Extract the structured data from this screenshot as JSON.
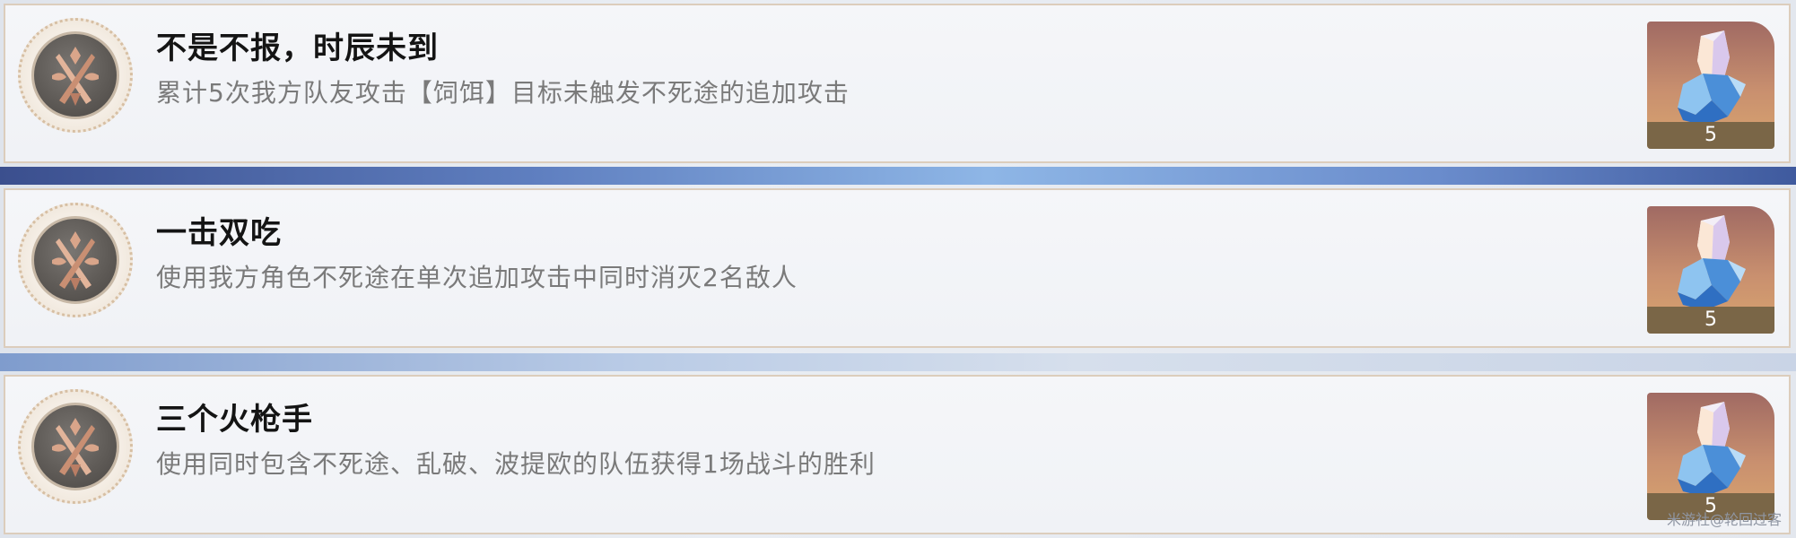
{
  "achievements": [
    {
      "title": "不是不报，时辰未到",
      "description": "累计5次我方队友攻击【饲饵】目标未触发不死途的追加攻击",
      "reward_count": "5",
      "medal_icon": "crossed-blades-medal-icon",
      "reward_icon": "stellar-jade-crystal-icon"
    },
    {
      "title": "一击双吃",
      "description": "使用我方角色不死途在单次追加攻击中同时消灭2名敌人",
      "reward_count": "5",
      "medal_icon": "crossed-blades-medal-icon",
      "reward_icon": "stellar-jade-crystal-icon"
    },
    {
      "title": "三个火枪手",
      "description": "使用同时包含不死途、乱破、波提欧的队伍获得1场战斗的胜利",
      "reward_count": "5",
      "medal_icon": "crossed-blades-medal-icon",
      "reward_icon": "stellar-jade-crystal-icon"
    }
  ],
  "watermark": "米游社@轮回过客",
  "colors": {
    "title_text": "#141414",
    "description_text": "#7a7a7a",
    "card_border": "#dccdbc",
    "reward_bg": "#c9906f",
    "reward_count_bar": "#7a6647",
    "band_blue": "#5f7fc0"
  }
}
